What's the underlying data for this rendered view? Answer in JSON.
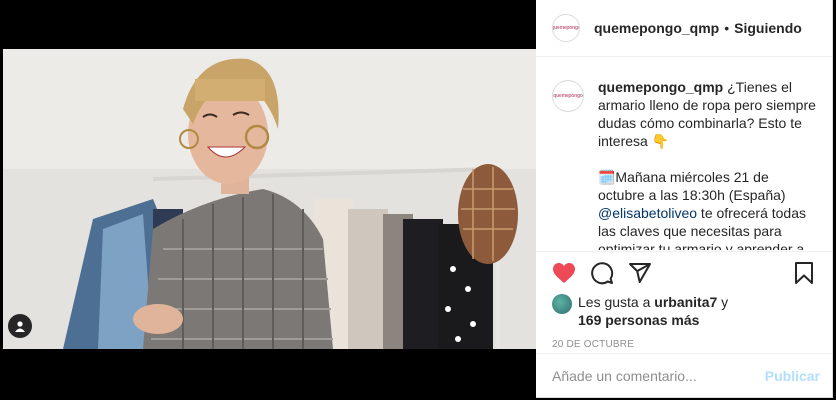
{
  "post": {
    "username": "quemepongo_qmp",
    "follow_separator": "•",
    "follow_label": "Siguiendo",
    "avatar_text": "quemepongo"
  },
  "caption": {
    "username": "quemepongo_qmp",
    "line1": "¿Tienes el armario lleno de ropa pero siempre dudas cómo combinarla? Esto te interesa 👇",
    "line2_prefix": "🗓️Mañana miércoles 21 de octubre a las 18:30h (España) ",
    "mention": "@elisabetoliveo",
    "line2_suffix": " te ofrecerá todas las claves que necesitas para optimizar tu armario y aprender a jugar con tus prendas y accesorios. 👉En este Workshop aprenderás a combinar colores"
  },
  "likes": {
    "prefix": "Les gusta a ",
    "user": "urbanita7",
    "connector": " y",
    "others": "169 personas más"
  },
  "date": "20 DE OCTUBRE",
  "comment_box": {
    "placeholder": "Añade un comentario...",
    "publish_label": "Publicar"
  },
  "icons": {
    "like": "heart-icon",
    "comment": "comment-icon",
    "share": "share-icon",
    "save": "bookmark-icon",
    "tag": "user-tag-icon"
  },
  "colors": {
    "like_red": "#ed4956",
    "publish_disabled": "#b2dffc",
    "mention": "#00376b",
    "text": "#262626",
    "muted": "#8e8e8e"
  }
}
